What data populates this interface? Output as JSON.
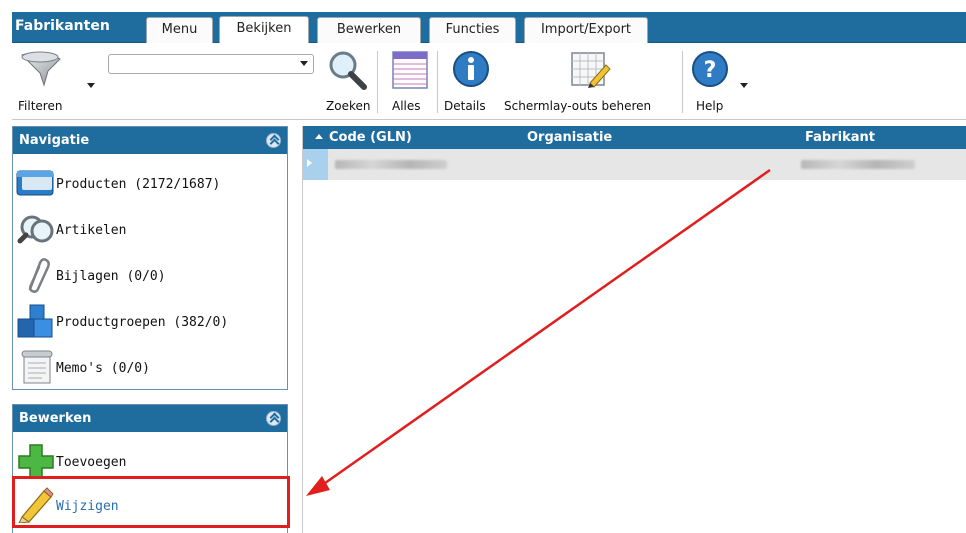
{
  "app_title": "Fabrikanten",
  "tabs": [
    {
      "label": "Menu"
    },
    {
      "label": "Bekijken"
    },
    {
      "label": "Bewerken"
    },
    {
      "label": "Functies"
    },
    {
      "label": "Import/Export"
    }
  ],
  "active_tab": "Bekijken",
  "ribbon": {
    "filter_label": "Filteren",
    "search_label": "Zoeken",
    "all_label": "Alles",
    "details_label": "Details",
    "layouts_label": "Schermlay-outs beheren",
    "help_label": "Help",
    "search_value": ""
  },
  "navigation": {
    "title": "Navigatie",
    "items": [
      {
        "label": "Producten (2172/1687)",
        "icon": "products-icon"
      },
      {
        "label": "Artikelen",
        "icon": "magnifier-icon"
      },
      {
        "label": "Bijlagen (0/0)",
        "icon": "paperclip-icon"
      },
      {
        "label": "Productgroepen (382/0)",
        "icon": "cubes-icon"
      },
      {
        "label": "Memo's (0/0)",
        "icon": "memo-icon"
      }
    ]
  },
  "edit_panel": {
    "title": "Bewerken",
    "items": [
      {
        "label": "Toevoegen",
        "icon": "plus-icon"
      },
      {
        "label": "Wijzigen",
        "icon": "pencil-icon"
      }
    ]
  },
  "grid": {
    "columns": [
      "Code (GLN)",
      "Organisatie",
      "Fabrikant"
    ]
  },
  "colors": {
    "header_blue": "#1f6c9f",
    "highlight_red": "#e01e1e",
    "link_blue": "#2a6fb0"
  }
}
